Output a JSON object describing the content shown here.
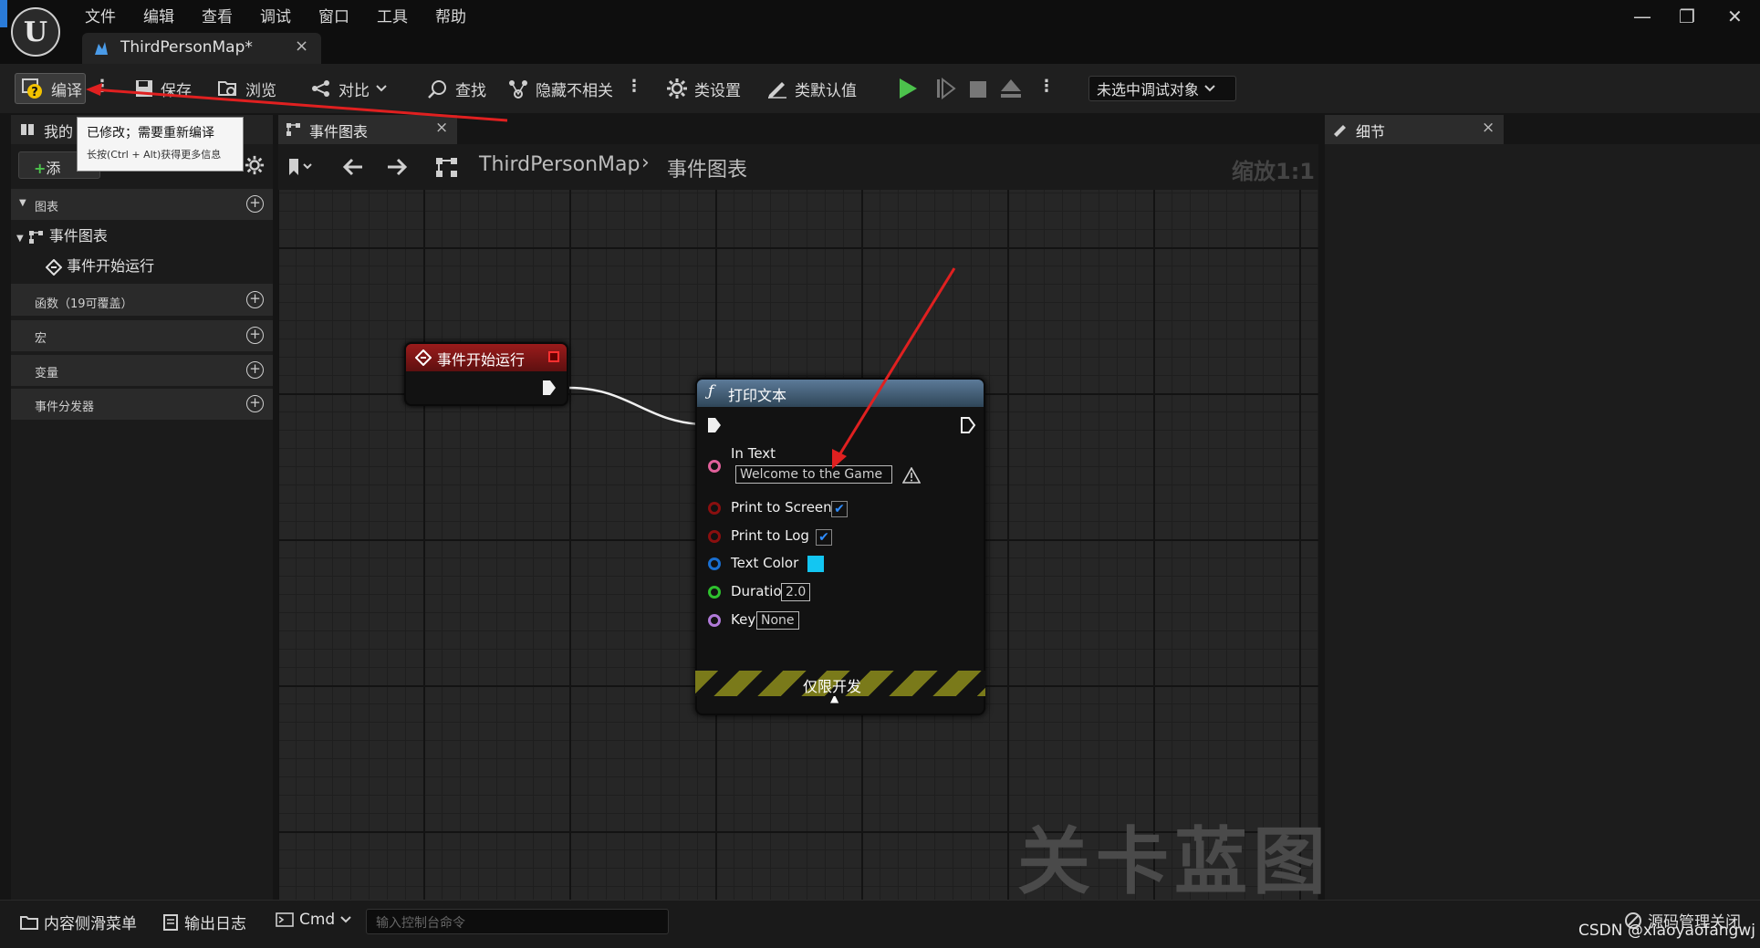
{
  "menu": [
    "文件",
    "编辑",
    "查看",
    "调试",
    "窗口",
    "工具",
    "帮助"
  ],
  "doc_tab": {
    "label": "ThirdPersonMap*",
    "close": "×"
  },
  "window_controls": {
    "minimize": "—",
    "restore": "❐",
    "close": "✕"
  },
  "toolbar": {
    "compile": "编译",
    "save": "保存",
    "browse": "浏览",
    "diff": "对比",
    "find": "查找",
    "hide_unrelated": "隐藏不相关",
    "class_settings": "类设置",
    "class_defaults": "类默认值",
    "debug_object": "未选中调试对象"
  },
  "tooltip": {
    "title": "已修改；需要重新编译",
    "hint": "长按(Ctrl + Alt)获得更多信息"
  },
  "my_blueprint": {
    "tab": "我的",
    "add": "添",
    "graphs": {
      "label": "图表",
      "items": [
        {
          "label": "事件图表",
          "children": [
            "事件开始运行"
          ]
        }
      ]
    },
    "functions": "函数（19可覆盖）",
    "macros": "宏",
    "variables": "变量",
    "dispatchers": "事件分发器"
  },
  "graph": {
    "tab": "事件图表",
    "breadcrumb": [
      "ThirdPersonMap",
      "事件图表"
    ],
    "zoom": "缩放1:1",
    "watermark": "关卡蓝图",
    "event_node": {
      "title": "事件开始运行"
    },
    "print_node": {
      "title": "打印文本",
      "in_text_label": "In Text",
      "in_text_value": "Welcome to the Game",
      "print_to_screen": "Print to Screen",
      "print_to_log": "Print to Log",
      "text_color": "Text Color",
      "text_color_value": "#13c6f2",
      "duration": "Duration",
      "duration_value": "2.0",
      "key": "Key",
      "key_value": "None",
      "dev_only": "仅限开发"
    }
  },
  "details": {
    "tab": "细节"
  },
  "bottom": {
    "content_drawer": "内容侧滑菜单",
    "output_log": "输出日志",
    "cmd": "Cmd",
    "console_placeholder": "输入控制台命令",
    "source_control": "源码管理关闭"
  },
  "watermark_csdn": "CSDN @xiaoyaofangwj"
}
